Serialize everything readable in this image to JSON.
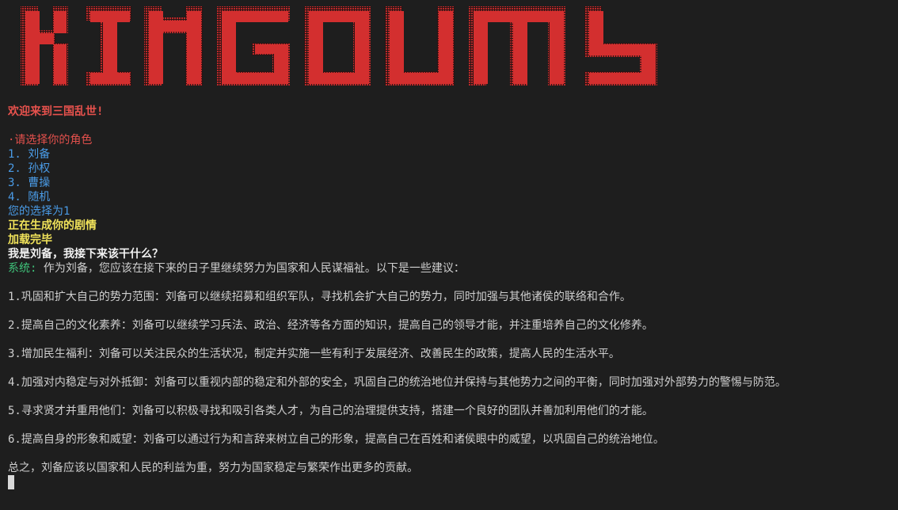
{
  "banner": {
    "art_label": "KINGDOMS",
    "color": "#d32f2f"
  },
  "welcome": "欢迎来到三国乱世!",
  "menu": {
    "prompt": "·请选择你的角色",
    "options": [
      "1. 刘备",
      "2. 孙权",
      "3. 曹操",
      "4. 随机"
    ],
    "choice": "您的选择为1"
  },
  "status": {
    "generating": "正在生成你的剧情",
    "loaded": "加载完毕"
  },
  "user_question": "我是刘备，我接下来该干什么？",
  "system": {
    "label": "系统:",
    "intro": " 作为刘备，您应该在接下来的日子里继续努力为国家和人民谋福祉。以下是一些建议：",
    "suggestions": [
      "1.巩固和扩大自己的势力范围：刘备可以继续招募和组织军队，寻找机会扩大自己的势力，同时加强与其他诸侯的联络和合作。",
      "2.提高自己的文化素养：刘备可以继续学习兵法、政治、经济等各方面的知识，提高自己的领导才能，并注重培养自己的文化修养。",
      "3.增加民生福利：刘备可以关注民众的生活状况，制定并实施一些有利于发展经济、改善民生的政策，提高人民的生活水平。",
      "4.加强对内稳定与对外抵御：刘备可以重视内部的稳定和外部的安全，巩固自己的统治地位并保持与其他势力之间的平衡，同时加强对外部势力的警惕与防范。",
      "5.寻求贤才并重用他们：刘备可以积极寻找和吸引各类人才，为自己的治理提供支持，搭建一个良好的团队并善加利用他们的才能。",
      "6.提高自身的形象和威望：刘备可以通过行为和言辞来树立自己的形象，提高自己在百姓和诸侯眼中的威望，以巩固自己的统治地位。"
    ],
    "conclusion": "总之，刘备应该以国家和人民的利益为重，努力为国家稳定与繁荣作出更多的贡献。"
  }
}
